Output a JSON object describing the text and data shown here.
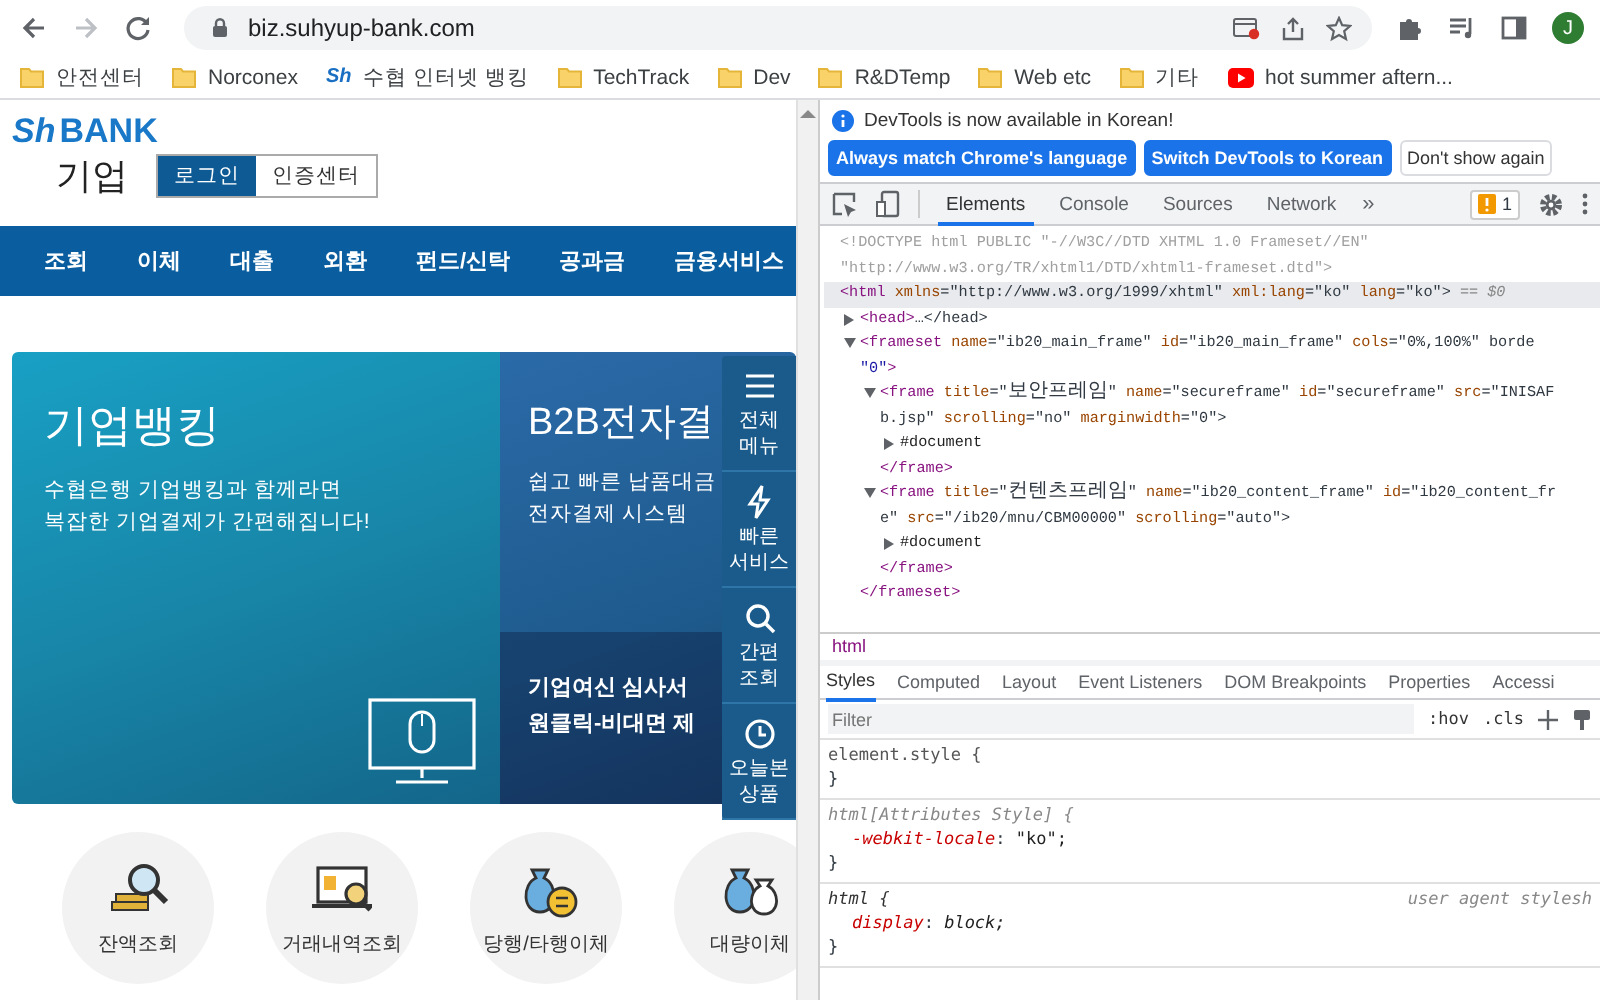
{
  "browser": {
    "url": "biz.suhyup-bank.com",
    "profile_initial": "J"
  },
  "bookmarks": [
    {
      "label": "안전센터",
      "kind": "folder"
    },
    {
      "label": "Norconex",
      "kind": "folder"
    },
    {
      "label": "수협 인터넷 뱅킹",
      "kind": "site",
      "icon_text": "Sh"
    },
    {
      "label": "TechTrack",
      "kind": "folder"
    },
    {
      "label": "Dev",
      "kind": "folder"
    },
    {
      "label": "R&DTemp",
      "kind": "folder"
    },
    {
      "label": "Web etc",
      "kind": "folder"
    },
    {
      "label": "기타",
      "kind": "folder"
    },
    {
      "label": "hot summer aftern...",
      "kind": "video"
    }
  ],
  "page": {
    "logo_mark": "Sh",
    "logo_text": "BANK",
    "subtitle": "기업",
    "header_buttons": [
      {
        "label": "로그인",
        "selected": true
      },
      {
        "label": "인증센터",
        "selected": false
      }
    ],
    "nav": [
      "조회",
      "이체",
      "대출",
      "외환",
      "펀드/신탁",
      "공과금",
      "금융서비스"
    ],
    "banners": [
      {
        "title": "기업뱅킹",
        "text": "수협은행 기업뱅킹과 함께라면\n복잡한 기업결제가 간편해집니다!"
      },
      {
        "title": "B2B전자결",
        "text": "쉽고 빠른 납품대금\n전자결제 시스템",
        "promo": "기업여신 심사서\n원클릭-비대면 제"
      }
    ],
    "quick_menu": [
      {
        "label": "전체 메뉴",
        "kind": "menu"
      },
      {
        "label": "빠른 서비스",
        "kind": "bolt"
      },
      {
        "label": "간편 조회",
        "kind": "search"
      },
      {
        "label": "오늘본 상품",
        "kind": "clock"
      }
    ],
    "services": [
      {
        "label": "잔액조회",
        "kind": "balance"
      },
      {
        "label": "거래내역조회",
        "kind": "history"
      },
      {
        "label": "당행/타행이체",
        "kind": "transfer"
      },
      {
        "label": "대량이체",
        "kind": "bulk"
      }
    ]
  },
  "devtools": {
    "info": "DevTools is now available in Korean!",
    "info_buttons": [
      {
        "label": "Always match Chrome's language",
        "kind": "primary"
      },
      {
        "label": "Switch DevTools to Korean",
        "kind": "primary"
      },
      {
        "label": "Don't show again",
        "kind": "plain"
      }
    ],
    "tabs": [
      {
        "label": "Elements",
        "selected": true
      },
      {
        "label": "Console",
        "selected": false
      },
      {
        "label": "Sources",
        "selected": false
      },
      {
        "label": "Network",
        "selected": false
      }
    ],
    "more_tabs": "»",
    "issues_count": "1",
    "tree": [
      {
        "kind": "doctype",
        "selected": false,
        "lines": [
          "<!DOCTYPE html PUBLIC \"-//W3C//DTD XHTML 1.0 Frameset//EN\"",
          "\"http://www.w3.org/TR/xhtml1/DTD/xhtml1-frameset.dtd\">"
        ]
      },
      {
        "kind": "element",
        "selected": true,
        "marker": "== $0",
        "lines": [
          "<html xmlns=\"http://www.w3.org/1999/xhtml\" xml:lang=\"ko\" lang=\"ko\">"
        ],
        "children": [
          {
            "kind": "element",
            "selected": false,
            "expanded": false,
            "lines": [
              "<head>…</head>"
            ]
          },
          {
            "kind": "element",
            "selected": false,
            "expanded": true,
            "lines": [
              "<frameset name=\"ib20_main_frame\" id=\"ib20_main_frame\" cols=\"0%,100%\" borde",
              "\"0\">"
            ],
            "closing": "</frameset>",
            "children": [
              {
                "kind": "element",
                "selected": false,
                "expanded": true,
                "lines": [
                  "<frame title=\"보안프레임\" name=\"secureframe\" id=\"secureframe\" src=\"INISAF",
                  "b.jsp\" scrolling=\"no\" marginwidth=\"0\">"
                ],
                "closing": "</frame>",
                "children": [
                  {
                    "kind": "document",
                    "selected": false,
                    "expanded": false,
                    "lines": [
                      "#document"
                    ]
                  }
                ]
              },
              {
                "kind": "element",
                "selected": false,
                "expanded": true,
                "lines": [
                  "<frame title=\"컨텐츠프레임\" name=\"ib20_content_frame\" id=\"ib20_content_fr",
                  "e\" src=\"/ib20/mnu/CBM00000\" scrolling=\"auto\">"
                ],
                "closing": "</frame>",
                "children": [
                  {
                    "kind": "document",
                    "selected": false,
                    "expanded": false,
                    "lines": [
                      "#document"
                    ]
                  }
                ]
              }
            ]
          }
        ]
      }
    ],
    "breadcrumb": "html",
    "style_tabs": [
      {
        "label": "Styles",
        "selected": true
      },
      {
        "label": "Computed",
        "selected": false
      },
      {
        "label": "Layout",
        "selected": false
      },
      {
        "label": "Event Listeners",
        "selected": false
      },
      {
        "label": "DOM Breakpoints",
        "selected": false
      },
      {
        "label": "Properties",
        "selected": false
      },
      {
        "label": "Accessi",
        "selected": false
      }
    ],
    "filter": {
      "placeholder": "Filter"
    },
    "filter_tools": [
      ":hov",
      ".cls"
    ],
    "rules": [
      {
        "kind": "inline",
        "selector": "element.style {",
        "close": "}"
      },
      {
        "kind": "attributes",
        "selector": "html[Attributes Style] {",
        "declarations": [
          {
            "name": "-webkit-locale",
            "separator": ":",
            "value": "\"ko\";"
          }
        ],
        "close": "}"
      },
      {
        "kind": "user-agent",
        "selector": "html {",
        "origin": "user agent stylesh",
        "declarations": [
          {
            "name": "display",
            "separator": ":",
            "value": "block;"
          }
        ],
        "close": "}"
      }
    ]
  }
}
